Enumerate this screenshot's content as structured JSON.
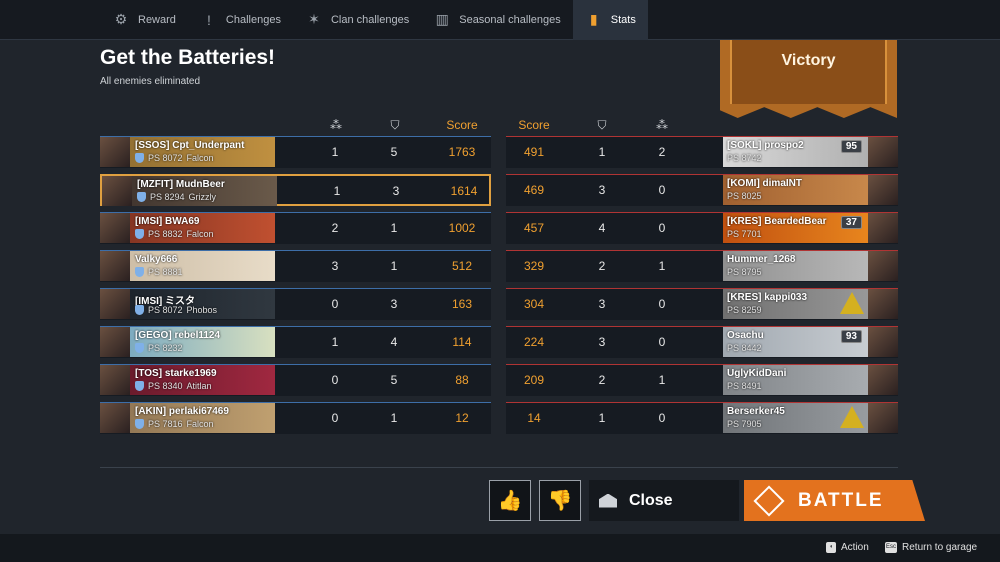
{
  "tabs": [
    {
      "label": "Reward",
      "icon": "gear-icon",
      "glyph": "⚙"
    },
    {
      "label": "Challenges",
      "icon": "alert-icon",
      "glyph": "!"
    },
    {
      "label": "Clan challenges",
      "icon": "clan-icon",
      "glyph": "✶"
    },
    {
      "label": "Seasonal challenges",
      "icon": "season-icon",
      "glyph": "▥"
    },
    {
      "label": "Stats",
      "icon": "stats-icon",
      "glyph": "▮"
    }
  ],
  "active_tab": 4,
  "title": "Get the Batteries!",
  "subtitle": "All enemies eliminated",
  "result": "Victory",
  "left_headers": {
    "kills_icon": "kills-icon",
    "assists_icon": "assists-icon",
    "score": "Score"
  },
  "right_headers": {
    "score": "Score",
    "assists_icon": "assists-icon",
    "kills_icon": "kills-icon"
  },
  "team_left": [
    {
      "name": "[SSOS] Cpt_Underpant",
      "ps": "PS 8072",
      "badge": "Falcon",
      "kills": "1",
      "assists": "5",
      "score": "1763",
      "me": false,
      "bg": [
        "#8a6a30",
        "#c09040"
      ]
    },
    {
      "name": "[MZFIT] MudnBeer",
      "ps": "PS 8294",
      "badge": "Grizzly",
      "kills": "1",
      "assists": "3",
      "score": "1614",
      "me": true,
      "bg": [
        "#3a2f2a",
        "#6a5a4a"
      ]
    },
    {
      "name": "[IMSI] BWA69",
      "ps": "PS 8832",
      "badge": "Falcon",
      "kills": "2",
      "assists": "1",
      "score": "1002",
      "me": false,
      "bg": [
        "#7a3020",
        "#c05030"
      ]
    },
    {
      "name": "Valky666",
      "ps": "PS 8881",
      "badge": "",
      "kills": "3",
      "assists": "1",
      "score": "512",
      "me": false,
      "bg": [
        "#c8b8a0",
        "#e8dcc8"
      ]
    },
    {
      "name": "[IMSI] ミスタ",
      "ps": "PS 8072",
      "badge": "Phobos",
      "kills": "0",
      "assists": "3",
      "score": "163",
      "me": false,
      "bg": [
        "#1a2028",
        "#303840"
      ]
    },
    {
      "name": "[GEGO] rebel1124",
      "ps": "PS 8232",
      "badge": "",
      "kills": "1",
      "assists": "4",
      "score": "114",
      "me": false,
      "bg": [
        "#6aa0c0",
        "#d8e0c0"
      ]
    },
    {
      "name": "[TOS] starke1969",
      "ps": "PS 8340",
      "badge": "Atitlan",
      "kills": "0",
      "assists": "5",
      "score": "88",
      "me": false,
      "bg": [
        "#601828",
        "#a02840"
      ]
    },
    {
      "name": "[AKIN] perlaki67469",
      "ps": "PS 7816",
      "badge": "Falcon",
      "kills": "0",
      "assists": "1",
      "score": "12",
      "me": false,
      "bg": [
        "#8a7050",
        "#c0a070"
      ]
    }
  ],
  "team_right": [
    {
      "name": "[SOKL] prospo2",
      "ps": "PS 8742",
      "score": "491",
      "assists": "1",
      "kills": "2",
      "rank": "95",
      "warn": false,
      "bg": [
        "#d8d8d8",
        "#a8a8a8"
      ]
    },
    {
      "name": "[KOMI] dimaINT",
      "ps": "PS 8025",
      "score": "469",
      "assists": "3",
      "kills": "0",
      "rank": "",
      "warn": false,
      "bg": [
        "#a06030",
        "#d09050"
      ]
    },
    {
      "name": "[KRES] BeardedBear",
      "ps": "PS 7701",
      "score": "457",
      "assists": "4",
      "kills": "0",
      "rank": "37",
      "warn": false,
      "bg": [
        "#c05010",
        "#f09020"
      ]
    },
    {
      "name": "Hummer_1268",
      "ps": "PS 8795",
      "score": "329",
      "assists": "2",
      "kills": "1",
      "rank": "",
      "warn": false,
      "bg": [
        "#909090",
        "#c0c0c0"
      ]
    },
    {
      "name": "[KRES] kappi033",
      "ps": "PS 8259",
      "score": "304",
      "assists": "3",
      "kills": "0",
      "rank": "",
      "warn": true,
      "bg": [
        "#707070",
        "#a0a0a0"
      ]
    },
    {
      "name": "Osachu",
      "ps": "PS 8442",
      "score": "224",
      "assists": "3",
      "kills": "0",
      "rank": "93",
      "warn": false,
      "bg": [
        "#a0a8b0",
        "#d0d4d8"
      ]
    },
    {
      "name": "UglyKidDani",
      "ps": "PS 8491",
      "score": "209",
      "assists": "2",
      "kills": "1",
      "rank": "",
      "warn": false,
      "bg": [
        "#808488",
        "#b0b4b8"
      ]
    },
    {
      "name": "Berserker45",
      "ps": "PS 7905",
      "score": "14",
      "assists": "1",
      "kills": "0",
      "rank": "",
      "warn": true,
      "bg": [
        "#707478",
        "#a0a4a8"
      ]
    }
  ],
  "buttons": {
    "like_icon": "thumbs-up-icon",
    "dislike_icon": "thumbs-down-icon",
    "close": "Close",
    "battle": "BATTLE"
  },
  "hints": [
    {
      "label": "Action",
      "key": "mouse"
    },
    {
      "label": "Return to garage",
      "key": "Esc"
    }
  ],
  "colors": {
    "accent": "#f0a030",
    "ally": "#3d6ea8",
    "enemy": "#b03434",
    "battle": "#e3721e"
  }
}
